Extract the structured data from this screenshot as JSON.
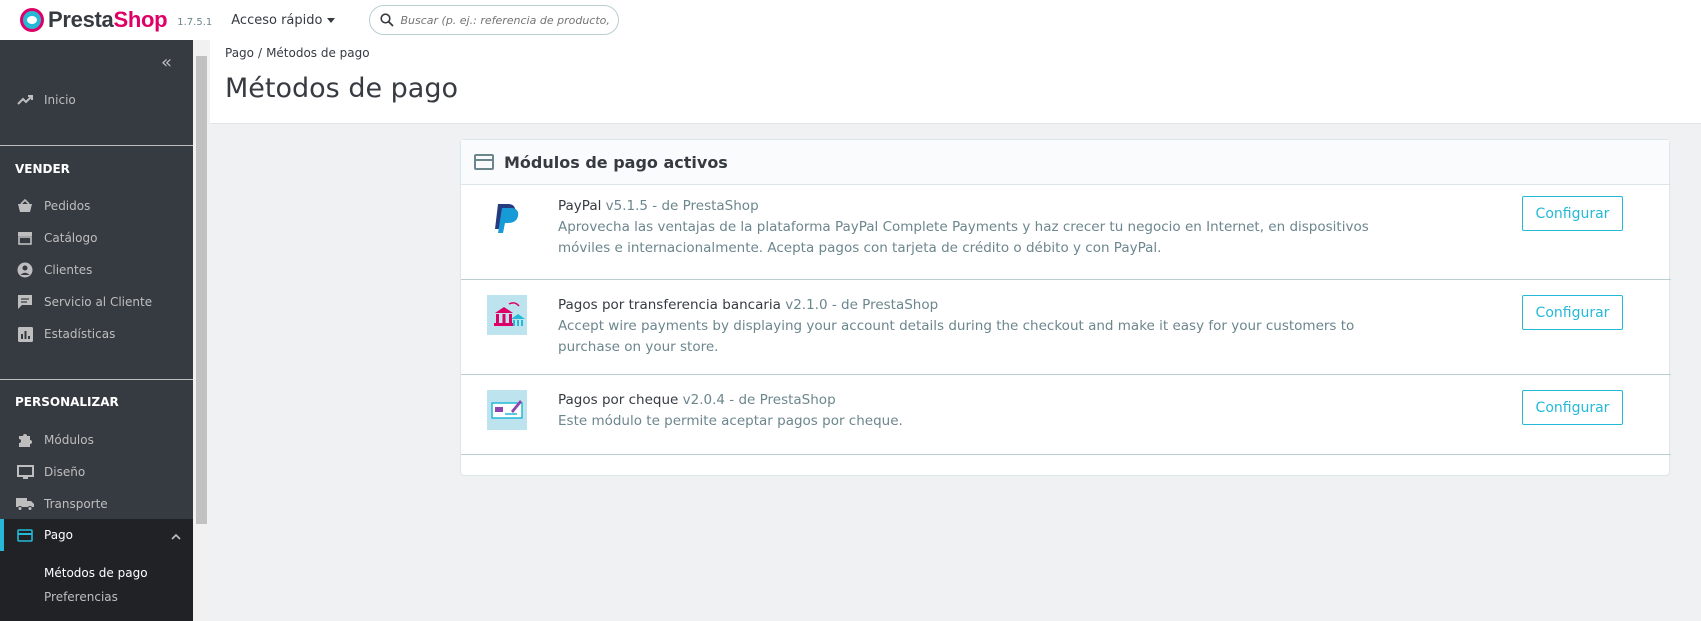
{
  "header": {
    "logo_part1": "Presta",
    "logo_part2": "Shop",
    "version": "1.7.5.1",
    "quick_access": "Acceso rápido",
    "search_placeholder": "Buscar (p. ej.: referencia de producto, nombre de cliente...)"
  },
  "sidebar": {
    "home": "Inicio",
    "section_sell": "VENDER",
    "sell_items": [
      "Pedidos",
      "Catálogo",
      "Clientes",
      "Servicio al Cliente",
      "Estadísticas"
    ],
    "section_customize": "PERSONALIZAR",
    "customize_items": [
      "Módulos",
      "Diseño",
      "Transporte"
    ],
    "active_item": "Pago",
    "sub_items": [
      "Métodos de pago",
      "Preferencias"
    ]
  },
  "breadcrumb": {
    "parent": "Pago",
    "current": "Métodos de pago"
  },
  "page_title": "Métodos de pago",
  "card": {
    "title": "Módulos de pago activos",
    "modules": [
      {
        "name": "PayPal",
        "version": "v5.1.5 - de PrestaShop",
        "description": "Aprovecha las ventajas de la plataforma PayPal Complete Payments y haz crecer tu negocio en Internet, en dispositivos móviles e internacionalmente. Acepta pagos con tarjeta de crédito o débito y con PayPal.",
        "button": "Configurar"
      },
      {
        "name": "Pagos por transferencia bancaria",
        "version": "v2.1.0 - de PrestaShop",
        "description": "Accept wire payments by displaying your account details during the checkout and make it easy for your customers to purchase on your store.",
        "button": "Configurar"
      },
      {
        "name": "Pagos por cheque",
        "version": "v2.0.4 - de PrestaShop",
        "description": "Este módulo te permite aceptar pagos por cheque.",
        "button": "Configurar"
      }
    ]
  },
  "colors": {
    "accent": "#25b9d7",
    "brand": "#df0067",
    "sidebar": "#363a41"
  }
}
